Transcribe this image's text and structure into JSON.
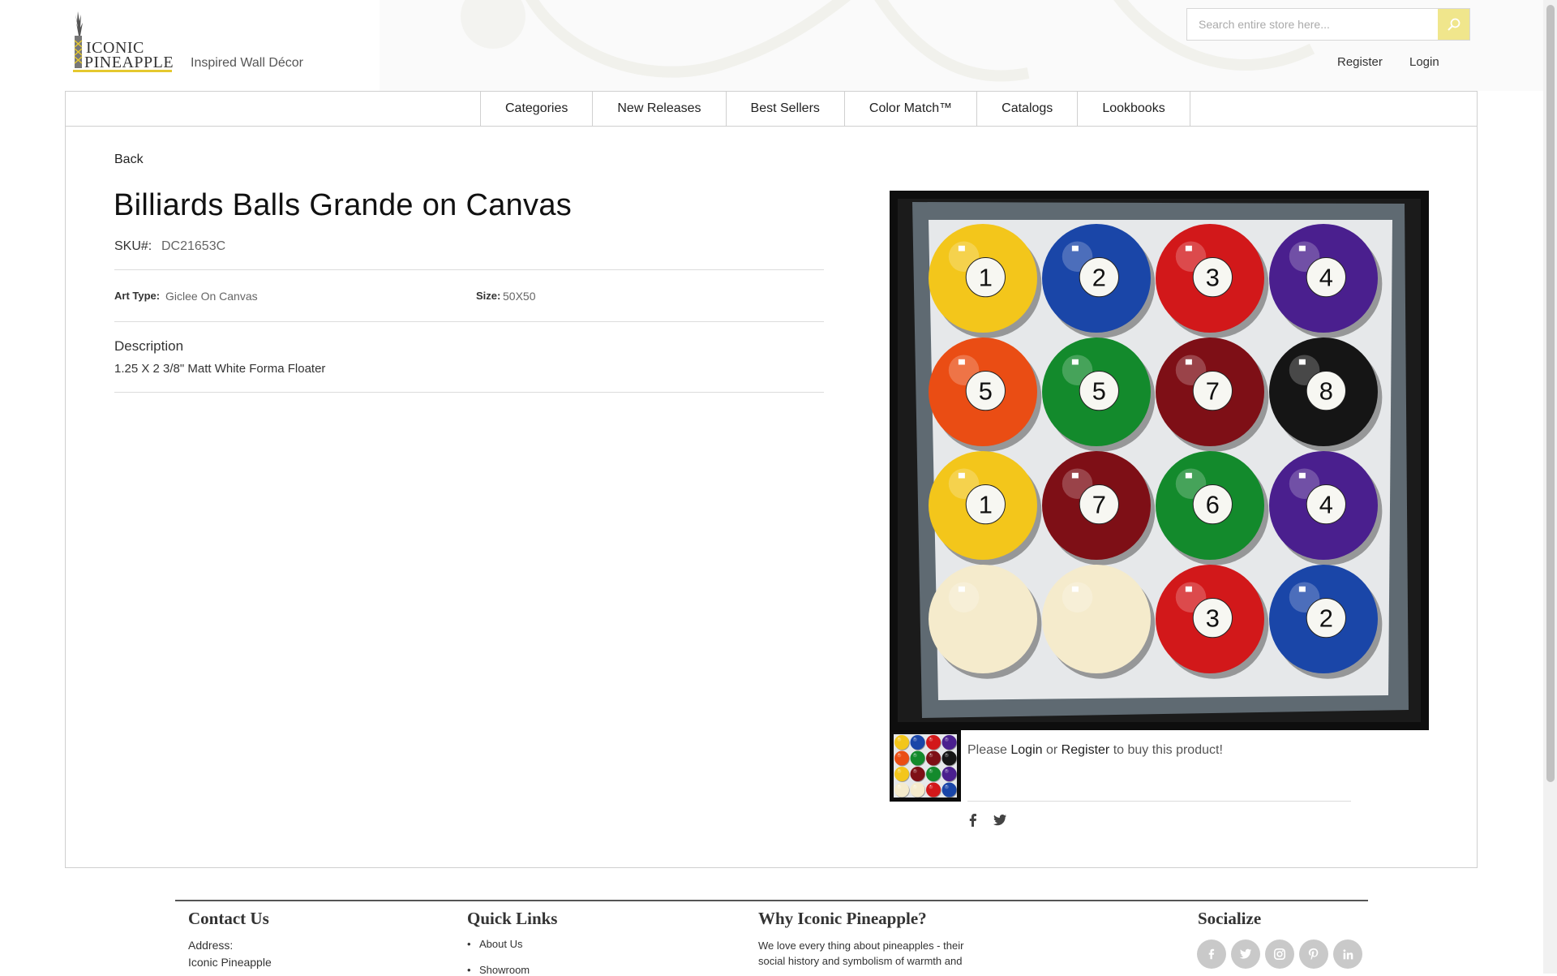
{
  "brand": {
    "logo_line1": "ICONIC",
    "logo_line2": "PINEAPPLE",
    "tagline": "Inspired Wall Décor",
    "accent": "#e5c82f"
  },
  "search": {
    "placeholder": "Search entire store here...",
    "icon": "search-icon"
  },
  "header_links": {
    "register": "Register",
    "login": "Login"
  },
  "nav": {
    "items": [
      "Categories",
      "New Releases",
      "Best Sellers",
      "Color Match™",
      "Catalogs",
      "Lookbooks"
    ]
  },
  "product": {
    "back": "Back",
    "title": "Billiards Balls Grande on Canvas",
    "sku_label": "SKU#:",
    "sku": "DC21653C",
    "art_type_label": "Art Type:",
    "art_type": "Giclee On Canvas",
    "size_label": "Size:",
    "size": "50X50",
    "description_title": "Description",
    "description": "1.25 X 2 3/8\" Matt White Forma Floater",
    "buy_prefix": "Please",
    "buy_login": "Login",
    "buy_or": "or",
    "buy_register": "Register",
    "buy_suffix": "to buy this product!",
    "balls": [
      {
        "n": "1",
        "color": "#f3c61b",
        "stripe": false
      },
      {
        "n": "2",
        "color": "#1a46a8",
        "stripe": false
      },
      {
        "n": "3",
        "color": "#d2181a",
        "stripe": false
      },
      {
        "n": "4",
        "color": "#4a1f8e",
        "stripe": false
      },
      {
        "n": "5",
        "color": "#ea4d14",
        "stripe": false
      },
      {
        "n": "5",
        "color": "#138a2c",
        "stripe": false
      },
      {
        "n": "7",
        "color": "#7e0f16",
        "stripe": false
      },
      {
        "n": "8",
        "color": "#151515",
        "stripe": false
      },
      {
        "n": "1",
        "color": "#f3c61b",
        "stripe": false
      },
      {
        "n": "7",
        "color": "#7e0f16",
        "stripe": false
      },
      {
        "n": "6",
        "color": "#138a2c",
        "stripe": false
      },
      {
        "n": "4",
        "color": "#4a1f8e",
        "stripe": false
      },
      {
        "n": "",
        "color": "#f5ebcc",
        "stripe": false
      },
      {
        "n": "",
        "color": "#f5ebcc",
        "stripe": false
      },
      {
        "n": "3",
        "color": "#d2181a",
        "stripe": false
      },
      {
        "n": "2",
        "color": "#1a46a8",
        "stripe": false
      }
    ],
    "share_icons": [
      "facebook-icon",
      "twitter-icon"
    ]
  },
  "footer": {
    "contact_title": "Contact Us",
    "address_label": "Address:",
    "address_line1": "Iconic Pineapple",
    "quick_links_title": "Quick Links",
    "quick_links": [
      "About Us",
      "Showroom"
    ],
    "why_title": "Why Iconic Pineapple?",
    "why_line1": "We love every thing about pineapples - their",
    "why_line2": "social history and symbolism of warmth and",
    "socialize_title": "Socialize",
    "social_icons": [
      "facebook-icon",
      "twitter-icon",
      "instagram-icon",
      "pinterest-icon",
      "linkedin-icon"
    ]
  }
}
